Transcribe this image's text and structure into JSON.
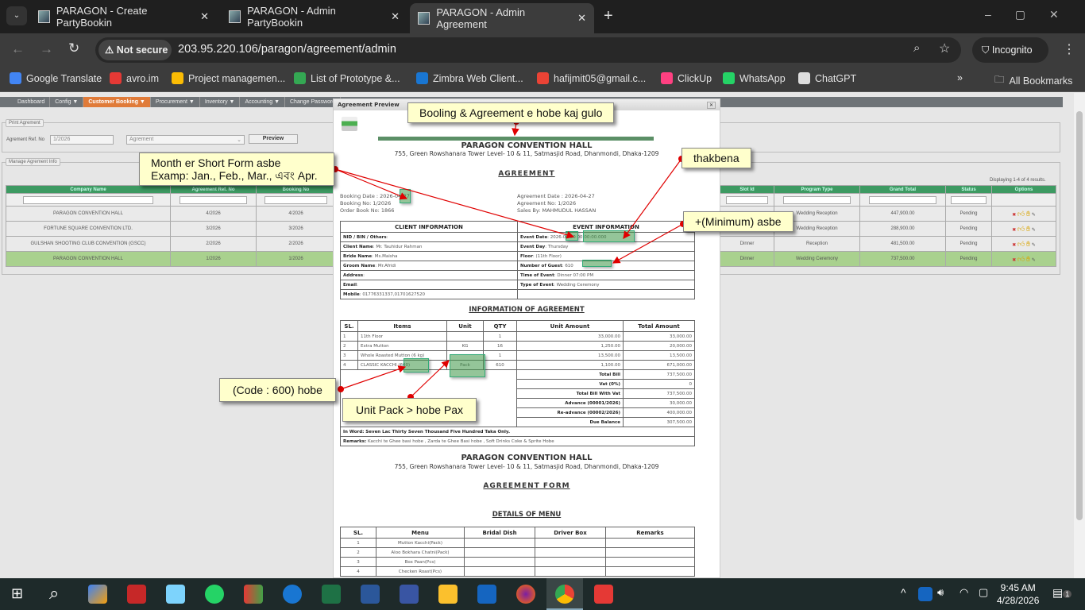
{
  "browser": {
    "tabs": [
      {
        "title": "PARAGON - Create PartyBookin",
        "active": false
      },
      {
        "title": "PARAGON - Admin PartyBookin",
        "active": false
      },
      {
        "title": "PARAGON - Admin Agreement",
        "active": true
      }
    ],
    "security": "Not secure",
    "url": "203.95.220.106/paragon/agreement/admin",
    "profile": "Incognito",
    "bookmarks": [
      {
        "label": "Google Translate",
        "color": "#4285f4"
      },
      {
        "label": "avro.im",
        "color": "#e53935"
      },
      {
        "label": "Project managemen...",
        "color": "#fbbc04"
      },
      {
        "label": "List of Prototype &...",
        "color": "#34a853"
      },
      {
        "label": "Zimbra Web Client...",
        "color": "#1976d2"
      },
      {
        "label": "hafijmit05@gmail.c...",
        "color": "#ea4335"
      },
      {
        "label": "ClickUp",
        "color": "#ff4081"
      },
      {
        "label": "WhatsApp",
        "color": "#25d366"
      },
      {
        "label": "ChatGPT",
        "color": "#dddddd"
      }
    ],
    "all_bookmarks": "All Bookmarks"
  },
  "nav": [
    "Dashboard",
    "Config ▼",
    "Customer Booking ▼",
    "Procurement ▼",
    "Inventory ▼",
    "Accounting ▼",
    "Change Password"
  ],
  "print": {
    "legend": "Print Agrement",
    "ref_label": "Agrement Ref. No",
    "ref_value": "1/2026",
    "type_value": "Agrement",
    "preview": "Preview"
  },
  "manage": {
    "legend": "Manage Agrement Info",
    "summary": "Displaying 1-4 of 4 results.",
    "headers": [
      "Company Name",
      "Agreement Ref. No",
      "Booking No",
      "Slot Id",
      "Program Type",
      "Grand Total",
      "Status",
      "Options"
    ],
    "rows": [
      [
        "PARAGON CONVENTION HALL",
        "4/2026",
        "4/2026",
        "",
        "Wedding Reception",
        "447,900.00",
        "Pending"
      ],
      [
        "FORTUNE SQUARE CONVENTION LTD.",
        "3/2026",
        "3/2026",
        "",
        "Wedding Reception",
        "288,900.00",
        "Pending"
      ],
      [
        "GULSHAN SHOOTING CLUB CONVENTION (GSCC)",
        "2/2026",
        "2/2026",
        "Dinner",
        "Reception",
        "481,500.00",
        "Pending"
      ],
      [
        "PARAGON CONVENTION HALL",
        "1/2026",
        "1/2026",
        "Dinner",
        "Wedding Ceremony",
        "737,500.00",
        "Pending"
      ]
    ]
  },
  "modal": {
    "title": "Agreement Preview",
    "hall": "PARAGON CONVENTION HALL",
    "address": "755, Green Rowshanara Tower Level- 10 & 11, Satmasjid Road, Dhanmondi, Dhaka-1209",
    "heading": "AGREEMENT",
    "meta_left": [
      "Booking Date : 2026-04-27",
      "Booking No: 1/2026",
      "Order Book No: 1866"
    ],
    "meta_right": [
      "Agreement Date : 2026-04-27",
      "Agreement No: 1/2026",
      "Sales By: MAHMUDUL HASSAN"
    ],
    "client_title": "CLIENT INFORMATION",
    "event_title": "EVENT INFORMATION",
    "client": [
      [
        "NID / BIN / Others",
        ""
      ],
      [
        "Client Name",
        "Mr. Tauhidur Rahman"
      ],
      [
        "Bride Name",
        "Ms.Maisha"
      ],
      [
        "Groom Name",
        "Mr.Afridi"
      ],
      [
        "Address",
        ""
      ],
      [
        "Email",
        ""
      ],
      [
        "Mobile",
        "01776331337,01701627520"
      ]
    ],
    "event": [
      [
        "Event Date",
        "2026-04-30 00:00:00.000"
      ],
      [
        "Event Day",
        "Thursday"
      ],
      [
        "Floor",
        "(11th Floor)"
      ],
      [
        "Number of Guest",
        "610"
      ],
      [
        "Time of Event",
        "Dinner 07:00 PM"
      ],
      [
        "Type of Event",
        "Wedding Ceremony"
      ],
      [
        "",
        ""
      ]
    ],
    "info_heading": "INFORMATION OF AGREEMENT",
    "item_headers": [
      "SL.",
      "Items",
      "Unit",
      "QTY",
      "Unit Amount",
      "Total Amount"
    ],
    "items": [
      [
        "1",
        "11th Floor",
        "",
        "1",
        "33,000.00",
        "33,000.00"
      ],
      [
        "2",
        "Extra Mutton",
        "KG",
        "16",
        "1,250.00",
        "20,000.00"
      ],
      [
        "3",
        "Whole Roasted Mutton (6 kg)",
        "",
        "1",
        "13,500.00",
        "13,500.00"
      ],
      [
        "4",
        "CLASSIC KACCHI (600)",
        "Pack",
        "610",
        "1,100.00",
        "671,000.00"
      ]
    ],
    "totals": [
      [
        "Total Bill",
        "737,500.00"
      ],
      [
        "Vat (0%)",
        "0"
      ],
      [
        "Total Bill With Vat",
        "737,500.00"
      ],
      [
        "Advance (00001/2026)",
        "30,000.00"
      ],
      [
        "Re-advance (00002/2026)",
        "400,000.00"
      ],
      [
        "Due Balance",
        "307,500.00"
      ]
    ],
    "in_word": "In Word: Seven Lac Thirty Seven Thousand Five Hundred Taka Only.",
    "remarks_label": "Remarks:",
    "remarks": "Kacchi te Ghee basi hobe , Zarda te Ghee Basi hobe , Soft Drinks Coke & Sprite Hobe",
    "form_heading": "AGREEMENT FORM",
    "menu_heading": "DETAILS OF MENU",
    "menu_headers": [
      "SL.",
      "Menu",
      "Bridal Dish",
      "Driver Box",
      "Remarks"
    ],
    "menu": [
      [
        "1",
        "Mutton Kacchi(Pack)"
      ],
      [
        "2",
        "Aloo Bokhara Chatni(Pack)"
      ],
      [
        "3",
        "Box Paan(Pcs)"
      ],
      [
        "4",
        "Checken Roast(Pcs)"
      ]
    ]
  },
  "annotations": {
    "a1": "Booling & Agreement e hobe kaj gulo",
    "a2_1": "Month er Short Form asbe",
    "a2_2": "Examp: Jan., Feb., Mar., এবং    Apr.",
    "a3": "thakbena",
    "a4": "+(Minimum) asbe",
    "a5": "(Code : 600) hobe",
    "a6": "Unit Pack > hobe Pax",
    "color_note": "#ffffcc",
    "color_arrow": "#e00000"
  },
  "taskbar": {
    "time": "9:45 AM",
    "date": "4/28/2026",
    "notifications": "1"
  }
}
